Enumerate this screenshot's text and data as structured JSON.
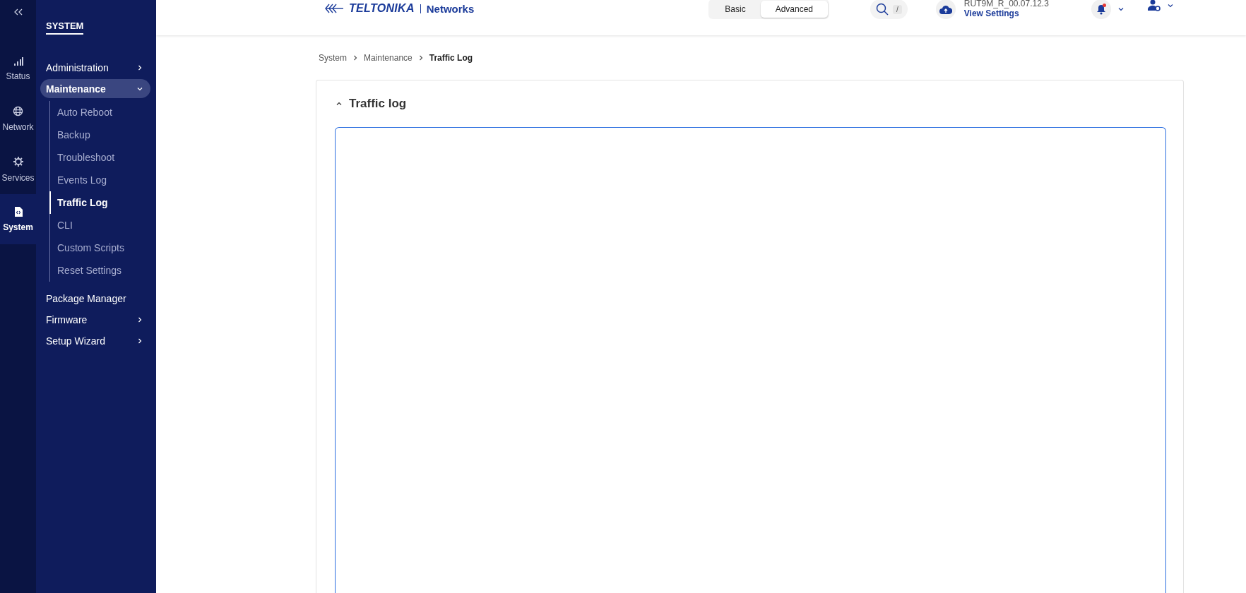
{
  "rail": {
    "items": [
      {
        "label": "Status",
        "kind": "signal",
        "selected": false
      },
      {
        "label": "Network",
        "kind": "globe",
        "selected": false
      },
      {
        "label": "Services",
        "kind": "gear",
        "selected": false
      },
      {
        "label": "System",
        "kind": "file",
        "selected": true
      }
    ]
  },
  "sidebar": {
    "title": "SYSTEM",
    "items": [
      {
        "label": "Administration",
        "kind": "group",
        "expanded": false
      },
      {
        "label": "Maintenance",
        "kind": "group",
        "expanded": true,
        "children": [
          {
            "label": "Auto Reboot",
            "selected": false
          },
          {
            "label": "Backup",
            "selected": false
          },
          {
            "label": "Troubleshoot",
            "selected": false
          },
          {
            "label": "Events Log",
            "selected": false
          },
          {
            "label": "Traffic Log",
            "selected": true
          },
          {
            "label": "CLI",
            "selected": false
          },
          {
            "label": "Custom Scripts",
            "selected": false
          },
          {
            "label": "Reset Settings",
            "selected": false
          }
        ]
      },
      {
        "label": "Package Manager",
        "kind": "link"
      },
      {
        "label": "Firmware",
        "kind": "group",
        "expanded": false
      },
      {
        "label": "Setup Wizard",
        "kind": "group",
        "expanded": false
      }
    ]
  },
  "header": {
    "logo": {
      "brand": "TELTONIKA",
      "product": "Networks"
    },
    "modes": [
      {
        "label": "Basic",
        "selected": false
      },
      {
        "label": "Advanced",
        "selected": true
      }
    ],
    "search_shortcut": "/",
    "device": {
      "firmware": "RUT9M_R_00.07.12.3",
      "link": "View Settings"
    },
    "notifications": {
      "unread": true
    }
  },
  "breadcrumb": [
    "System",
    "Maintenance",
    "Traffic Log"
  ],
  "section": {
    "title": "Traffic log",
    "expanded": true
  }
}
